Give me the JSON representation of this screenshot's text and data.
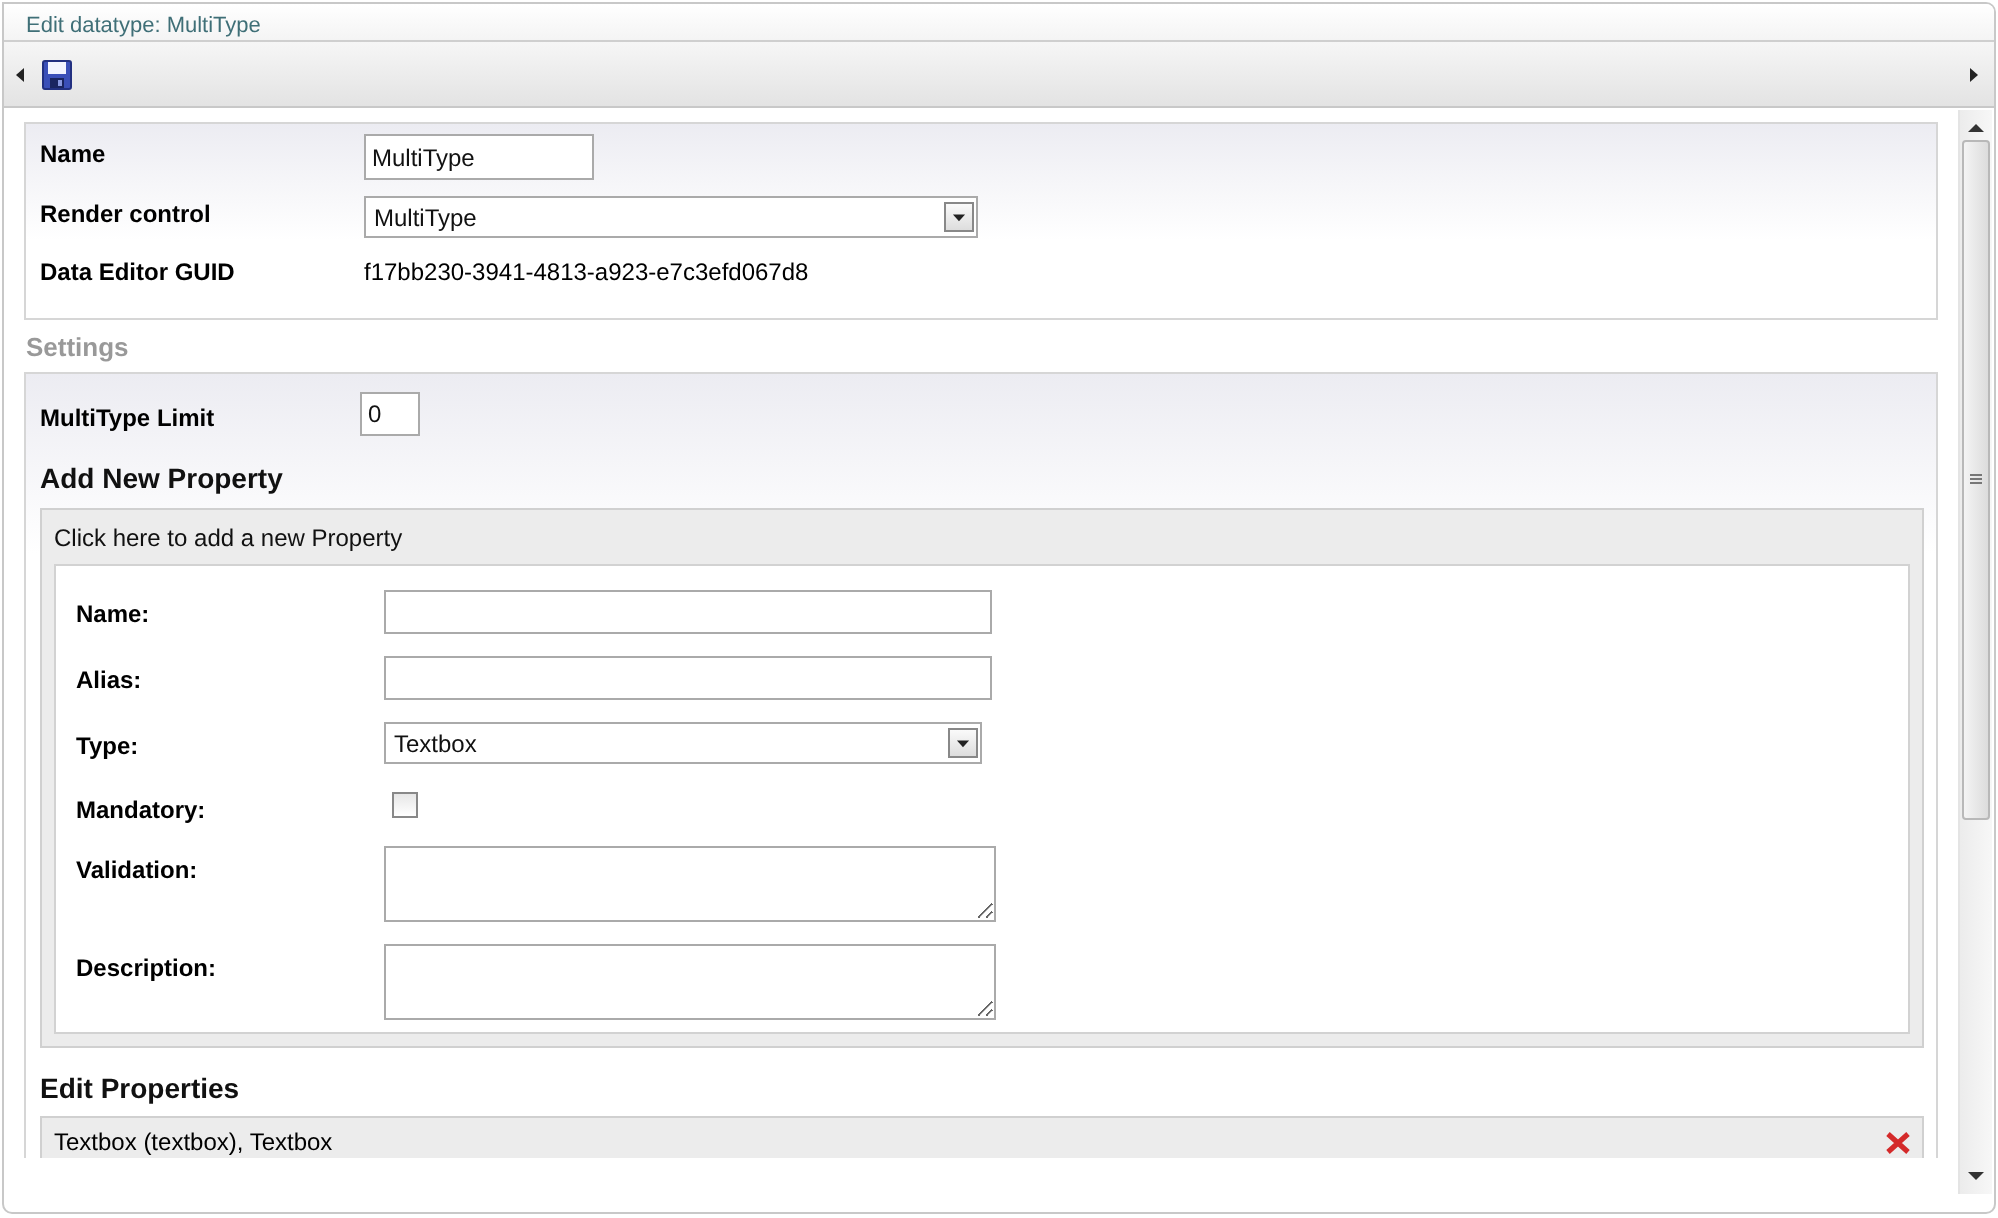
{
  "window": {
    "title": "Edit datatype: MultiType"
  },
  "general": {
    "fields": [
      {
        "label": "Name",
        "kind": "text",
        "value": "MultiType"
      },
      {
        "label": "Render control",
        "kind": "select",
        "value": "MultiType"
      },
      {
        "label": "Data Editor GUID",
        "kind": "static",
        "value": "f17bb230-3941-4813-a923-e7c3efd067d8"
      }
    ]
  },
  "settings": {
    "title": "Settings",
    "fields": [
      {
        "label": "MultiType Limit",
        "kind": "short",
        "value": "0"
      }
    ]
  },
  "add_property": {
    "title": "Add New Property",
    "toggle": "Click here to add a new Property",
    "fields": [
      {
        "label": "Name:",
        "kind": "text"
      },
      {
        "label": "Alias:",
        "kind": "text"
      },
      {
        "label": "Type:",
        "kind": "select",
        "value": "Textbox"
      },
      {
        "label": "Mandatory:",
        "kind": "checkbox",
        "checked": false
      },
      {
        "label": "Validation:",
        "kind": "textarea"
      },
      {
        "label": "Description:",
        "kind": "textarea"
      }
    ]
  },
  "edit_properties": {
    "title": "Edit Properties",
    "items": [
      {
        "label": "Textbox (textbox), Textbox"
      }
    ]
  }
}
